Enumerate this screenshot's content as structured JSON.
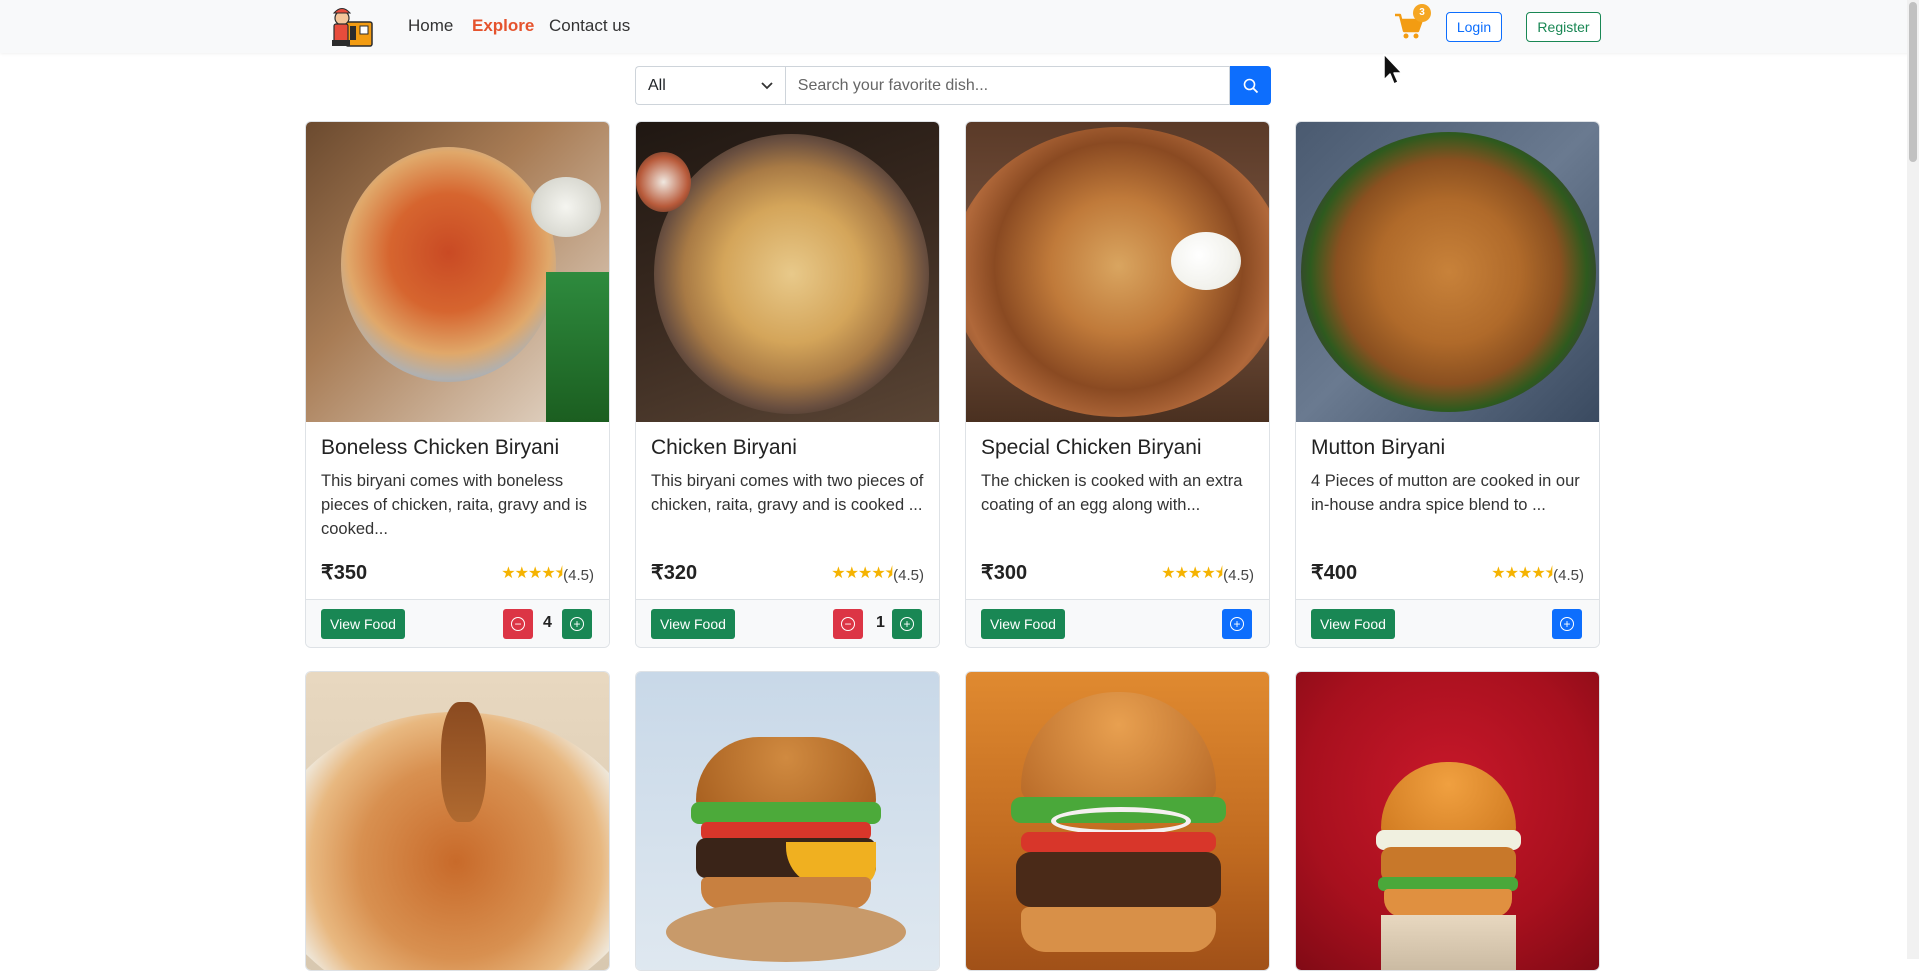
{
  "navbar": {
    "logo_icon": "chef-delivery-logo",
    "links": [
      {
        "label": "Home",
        "active": false
      },
      {
        "label": "Explore",
        "active": true
      },
      {
        "label": "Contact us",
        "active": false
      }
    ],
    "cart_icon": "shopping-cart-icon",
    "cart_count": "3",
    "login_label": "Login",
    "register_label": "Register"
  },
  "search": {
    "category_selected": "All",
    "placeholder": "Search your favorite dish...",
    "button_icon": "search-icon"
  },
  "cards": [
    {
      "title": "Boneless Chicken Biryani",
      "description": "This biryani comes with boneless pieces of chicken, raita, gravy and is cooked...",
      "price": "₹350",
      "stars": "★★★★⯨",
      "rating": "(4.5)",
      "view_label": "View Food",
      "quantity": "4"
    },
    {
      "title": "Chicken Biryani",
      "description": "This biryani comes with two pieces of chicken, raita, gravy and is cooked ...",
      "price": "₹320",
      "stars": "★★★★⯨",
      "rating": "(4.5)",
      "view_label": "View Food",
      "quantity": "1"
    },
    {
      "title": "Special Chicken Biryani",
      "description": "The chicken is cooked with an extra coating of an egg along with...",
      "price": "₹300",
      "stars": "★★★★⯨",
      "rating": "(4.5)",
      "view_label": "View Food",
      "quantity": null
    },
    {
      "title": "Mutton Biryani",
      "description": "4 Pieces of mutton are cooked in our in-house andra spice blend to ...",
      "price": "₹400",
      "stars": "★★★★⯨",
      "rating": "(4.5)",
      "view_label": "View Food",
      "quantity": null
    }
  ],
  "colors": {
    "accent_active": "#e5532d",
    "primary": "#0d6efd",
    "success": "#198754",
    "danger": "#dc3545",
    "star": "#f5b301"
  }
}
